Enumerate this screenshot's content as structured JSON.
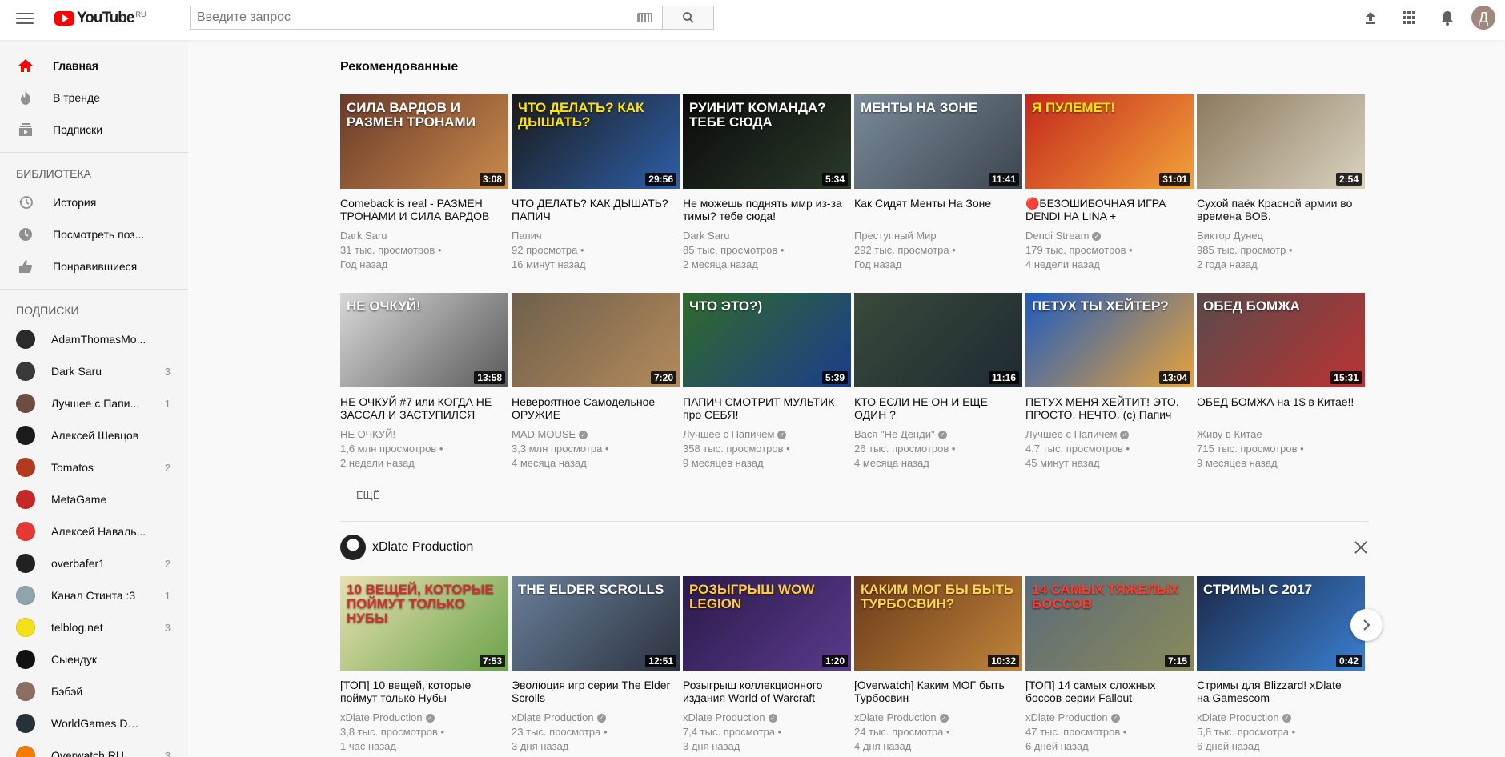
{
  "header": {
    "logo_text": "YouTube",
    "logo_region": "RU",
    "search_placeholder": "Введите запрос",
    "avatar_letter": "Д"
  },
  "sidebar": {
    "main": [
      {
        "label": "Главная",
        "icon": "home-icon",
        "active": true
      },
      {
        "label": "В тренде",
        "icon": "flame-icon"
      },
      {
        "label": "Подписки",
        "icon": "subscriptions-icon"
      }
    ],
    "library_heading": "БИБЛИОТЕКА",
    "library": [
      {
        "label": "История",
        "icon": "history-icon"
      },
      {
        "label": "Посмотреть поз...",
        "icon": "clock-icon"
      },
      {
        "label": "Понравившиеся",
        "icon": "thumb-up-icon"
      }
    ],
    "subs_heading": "ПОДПИСКИ",
    "subscriptions": [
      {
        "name": "AdamThomasMo...",
        "count": "",
        "color": "#2a2a2a"
      },
      {
        "name": "Dark Saru",
        "count": "3",
        "color": "#3a3a3a"
      },
      {
        "name": "Лучшее с Папи...",
        "count": "1",
        "color": "#6d4c41"
      },
      {
        "name": "Алексей Шевцов",
        "count": "",
        "color": "#1b1b1b"
      },
      {
        "name": "Tomatos",
        "count": "2",
        "color": "#b23a1e"
      },
      {
        "name": "MetaGame",
        "count": "",
        "color": "#c62828"
      },
      {
        "name": "Алексей Наваль...",
        "count": "",
        "color": "#e53935"
      },
      {
        "name": "overbafer1",
        "count": "2",
        "color": "#212121"
      },
      {
        "name": "Канал Стинта :3",
        "count": "1",
        "color": "#90a4ae"
      },
      {
        "name": "telblog.net",
        "count": "3",
        "color": "#f5e11b"
      },
      {
        "name": "Сыендук",
        "count": "",
        "color": "#111111"
      },
      {
        "name": "Бэбэй",
        "count": "",
        "color": "#8d6e63"
      },
      {
        "name": "WorldGames DOTA",
        "count": "",
        "color": "#263238"
      },
      {
        "name": "Overwatch RU",
        "count": "3",
        "color": "#f57c00"
      }
    ]
  },
  "recommended": {
    "title": "Рекомендованные",
    "more_label": "Ещё",
    "videos": [
      {
        "title": "Comeback is real - РАЗМЕН ТРОНАМИ И СИЛА ВАРДОВ",
        "channel": "Dark Saru",
        "verified": false,
        "views": "31 тыс. просмотров",
        "age": "Год назад",
        "duration": "3:08",
        "thumb_text": "СИЛА ВАРДОВ И РАЗМЕН ТРОНАМИ",
        "thumb_color": "#6b3b2a",
        "thumb_color2": "#c98a4b",
        "thumb_text_color": "#ffffff"
      },
      {
        "title": "ЧТО ДЕЛАТЬ? КАК ДЫШАТЬ? ПАПИЧ",
        "channel": "Папич",
        "verified": false,
        "views": "92 просмотра",
        "age": "16 минут назад",
        "duration": "29:56",
        "thumb_text": "ЧТО ДЕЛАТЬ? КАК ДЫШАТЬ?",
        "thumb_color": "#1a1a1a",
        "thumb_color2": "#2e5fa8",
        "thumb_text_color": "#ffe600"
      },
      {
        "title": "Не можешь поднять ммр из-за тимы? тебе сюда!",
        "channel": "Dark Saru",
        "verified": false,
        "views": "85 тыс. просмотров",
        "age": "2 месяца назад",
        "duration": "5:34",
        "thumb_text": "РУИНИТ КОМАНДА? ТЕБЕ СЮДА",
        "thumb_color": "#0a0a0a",
        "thumb_color2": "#2a3a2a",
        "thumb_text_color": "#ffffff"
      },
      {
        "title": "Как Сидят Менты На Зоне",
        "channel": "Преступный Мир",
        "verified": false,
        "views": "292 тыс. просмотра",
        "age": "Год назад",
        "duration": "11:41",
        "thumb_text": "МЕНТЫ НА ЗОНЕ",
        "thumb_color": "#7a8a99",
        "thumb_color2": "#3c4650",
        "thumb_text_color": "#ffffff"
      },
      {
        "title": "🔴БЕЗОШИБОЧНАЯ ИГРА DENDI НА LINA +",
        "channel": "Dendi Stream",
        "verified": true,
        "views": "179 тыс. просмотров",
        "age": "4 недели назад",
        "duration": "31:01",
        "thumb_text": "Я ПУЛЕМЕТ!",
        "thumb_color": "#c4281c",
        "thumb_color2": "#f2a33a",
        "thumb_text_color": "#ffe600"
      },
      {
        "title": "Сухой паёк Красной армии во времена ВОВ.",
        "channel": "Виктор Дунец",
        "verified": false,
        "views": "985 тыс. просмотр",
        "age": "2 года назад",
        "duration": "2:54",
        "thumb_text": "",
        "thumb_color": "#8c7a5c",
        "thumb_color2": "#d9d2c0",
        "thumb_text_color": "#ffffff"
      },
      {
        "title": "НЕ ОЧКУЙ #7 или КОГДА НЕ ЗАССАЛ И ЗАСТУПИЛСЯ",
        "channel": "НЕ ОЧКУЙ!",
        "verified": false,
        "views": "1,6 млн просмотров",
        "age": "2 недели назад",
        "duration": "13:58",
        "thumb_text": "НЕ ОЧКУЙ!",
        "thumb_color": "#d8d8d8",
        "thumb_color2": "#5a5a5a",
        "thumb_text_color": "#ffffff"
      },
      {
        "title": "Невероятное Самодельное ОРУЖИЕ",
        "channel": "MAD MOUSE",
        "verified": true,
        "views": "3,3 млн просмотра",
        "age": "4 месяца назад",
        "duration": "7:20",
        "thumb_text": "",
        "thumb_color": "#6f5f4c",
        "thumb_color2": "#b38a5a",
        "thumb_text_color": "#ffffff"
      },
      {
        "title": "ПАПИЧ СМОТРИТ МУЛЬТИК про СЕБЯ!",
        "channel": "Лучшее с Папичем",
        "verified": true,
        "views": "358 тыс. просмотров",
        "age": "9 месяцев назад",
        "duration": "5:39",
        "thumb_text": "ЧТО ЭТО?)",
        "thumb_color": "#2f6b2a",
        "thumb_color2": "#1b3d8c",
        "thumb_text_color": "#ffffff"
      },
      {
        "title": "КТО ЕСЛИ НЕ ОН И ЕЩЕ ОДИН ?",
        "channel": "Вася \"Не Денди\"",
        "verified": true,
        "views": "26 тыс. просмотров",
        "age": "4 месяца назад",
        "duration": "11:16",
        "thumb_text": "",
        "thumb_color": "#3a4a3a",
        "thumb_color2": "#1e2a33",
        "thumb_text_color": "#ffffff"
      },
      {
        "title": "ПЕТУХ МЕНЯ ХЕЙТИТ! ЭТО. ПРОСТО. НЕЧТО. (с) Папич",
        "channel": "Лучшее с Папичем",
        "verified": true,
        "views": "4,7 тыс. просмотров",
        "age": "45 минут назад",
        "duration": "13:04",
        "thumb_text": "ПЕТУХ ТЫ ХЕЙТЕР?",
        "thumb_color": "#1e5bbf",
        "thumb_color2": "#e8a23a",
        "thumb_text_color": "#ffffff"
      },
      {
        "title": "ОБЕД БОМЖА на 1$ в Китае!!",
        "channel": "Живу в Китае",
        "verified": false,
        "views": "715 тыс. просмотров",
        "age": "9 месяцев назад",
        "duration": "15:31",
        "thumb_text": "ОБЕД БОМЖА",
        "thumb_color": "#5a4a4a",
        "thumb_color2": "#b33",
        "thumb_text_color": "#ffffff"
      }
    ]
  },
  "channel_shelf": {
    "name": "xDlate Production",
    "videos": [
      {
        "title": "[ТОП] 10 вещей, которые поймут только Нубы",
        "channel": "xDlate Production",
        "verified": true,
        "views": "3,8 тыс. просмотров",
        "age": "1 час назад",
        "duration": "7:53",
        "thumb_text": "10 ВЕЩЕЙ, КОТОРЫЕ ПОЙМУТ ТОЛЬКО НУБЫ",
        "thumb_color": "#e8e0b0",
        "thumb_color2": "#6aa34a",
        "thumb_text_color": "#d32f2f"
      },
      {
        "title": "Эволюция игр серии The Elder Scrolls",
        "channel": "xDlate Production",
        "verified": true,
        "views": "23 тыс. просмотра",
        "age": "3 дня назад",
        "duration": "12:51",
        "thumb_text": "The Elder Scrolls",
        "thumb_color": "#6a7f99",
        "thumb_color2": "#2b3340",
        "thumb_text_color": "#ffffff"
      },
      {
        "title": "Розыгрыш коллекционного издания World of Warcraft",
        "channel": "xDlate Production",
        "verified": true,
        "views": "7,4 тыс. просмотра",
        "age": "3 дня назад",
        "duration": "1:20",
        "thumb_text": "РОЗЫГРЫШ WoW Legion",
        "thumb_color": "#2a1a4a",
        "thumb_color2": "#5b3a8c",
        "thumb_text_color": "#ffcc33"
      },
      {
        "title": "[Overwatch] Каким МОГ быть Турбосвин",
        "channel": "xDlate Production",
        "verified": true,
        "views": "24 тыс. просмотра",
        "age": "4 дня назад",
        "duration": "10:32",
        "thumb_text": "КАКИМ МОГ БЫ БЫТЬ ТУРБОСВИН?",
        "thumb_color": "#6b3a1a",
        "thumb_color2": "#c0843a",
        "thumb_text_color": "#ffd54f"
      },
      {
        "title": "[ТОП] 14 самых сложных боссов серии Fallout",
        "channel": "xDlate Production",
        "verified": true,
        "views": "47 тыс. просмотров",
        "age": "6 дней назад",
        "duration": "7:15",
        "thumb_text": "14 самых тяжелых боссов",
        "thumb_color": "#5a6b7a",
        "thumb_color2": "#8a8a5a",
        "thumb_text_color": "#ff3b30"
      },
      {
        "title": "Стримы для Blizzard! xDlate на Gamescom",
        "channel": "xDlate Production",
        "verified": true,
        "views": "5,8 тыс. просмотра",
        "age": "6 дней назад",
        "duration": "0:42",
        "thumb_text": "Стримы с 2017",
        "thumb_color": "#1c2a4a",
        "thumb_color2": "#3a7fd0",
        "thumb_text_color": "#ffffff"
      }
    ]
  }
}
